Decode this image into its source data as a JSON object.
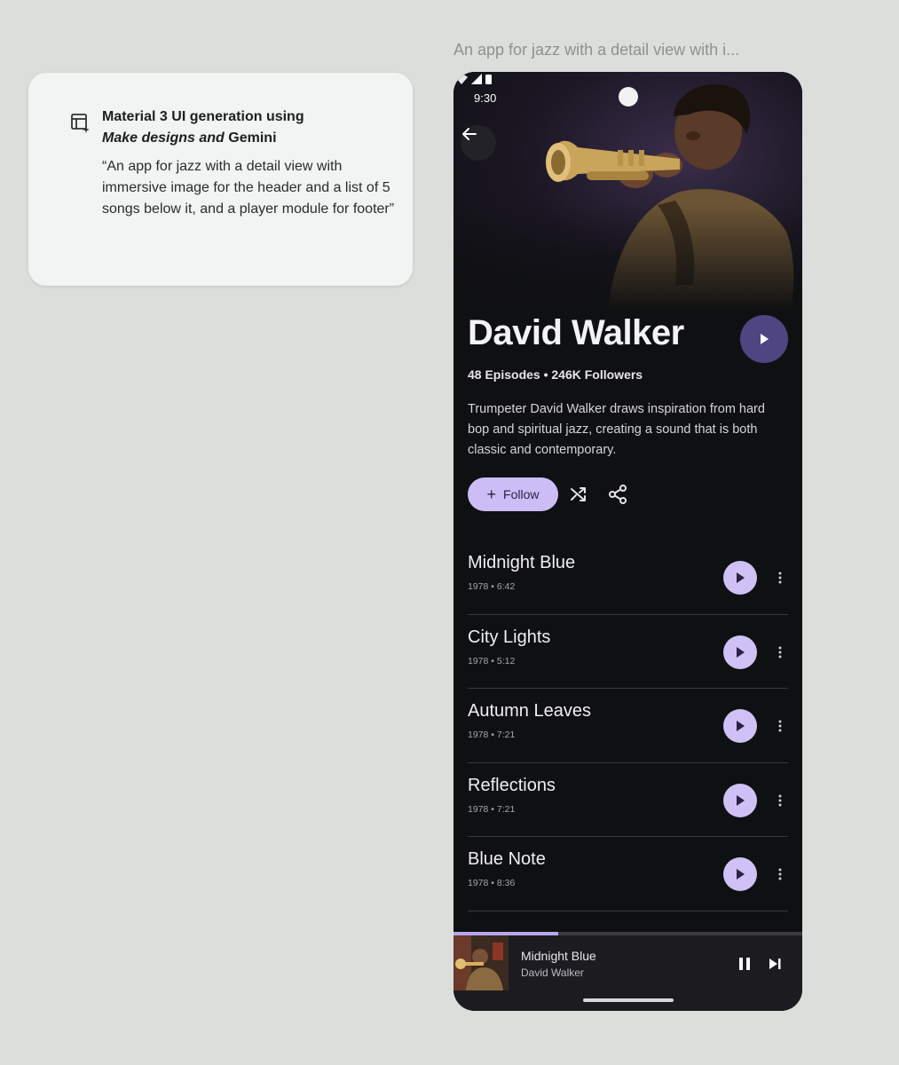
{
  "prompt": {
    "title": "Material 3 UI generation using",
    "subtitle_part1": "Make designs and",
    "subtitle_part2": "Gemini",
    "quote": "“An app for jazz with a detail view with immersive image for the header and a list of 5 songs below it, and a player module for footer”",
    "icon": "layout-sparkle-icon"
  },
  "caption": "An app for jazz with a detail view with i...",
  "status": {
    "time": "9:30"
  },
  "artist": {
    "name": "David Walker",
    "stats": "48 Episodes • 246K Followers",
    "bio": "Trumpeter David Walker draws inspiration from hard bop and spiritual jazz, creating a sound that is both classic and contemporary."
  },
  "actions": {
    "follow_label": "Follow"
  },
  "songs": [
    {
      "title": "Midnight Blue",
      "meta": "1978 • 6:42"
    },
    {
      "title": "City Lights",
      "meta": "1978 • 5:12"
    },
    {
      "title": "Autumn Leaves",
      "meta": "1978 • 7:21"
    },
    {
      "title": "Reflections",
      "meta": "1978 • 7:21"
    },
    {
      "title": "Blue Note",
      "meta": "1978 • 8:36"
    }
  ],
  "player": {
    "title": "Midnight Blue",
    "artist": "David Walker",
    "progress": 0.3
  },
  "colors": {
    "accent": "#cdbdf7",
    "hero_play": "#4f4580",
    "background": "#0f1012"
  }
}
